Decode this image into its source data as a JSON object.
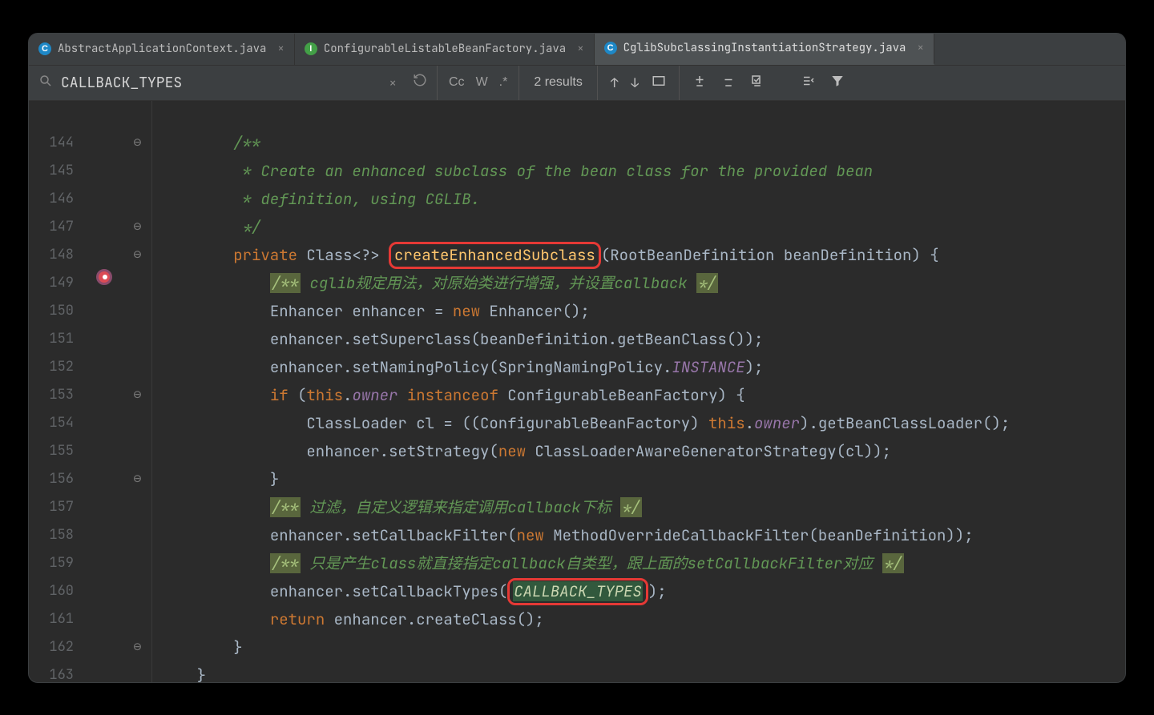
{
  "tabs": [
    {
      "icon": "c",
      "label": "AbstractApplicationContext.java",
      "active": false
    },
    {
      "icon": "i",
      "label": "ConfigurableListableBeanFactory.java",
      "active": false
    },
    {
      "icon": "c",
      "label": "CglibSubclassingInstantiationStrategy.java",
      "active": true
    }
  ],
  "search": {
    "query": "CALLBACK_TYPES",
    "results": "2 results",
    "opts": {
      "case": "Cc",
      "words": "W",
      "regex": ".*"
    }
  },
  "gutter": {
    "lines": [
      "",
      "144",
      "145",
      "146",
      "147",
      "148",
      "149",
      "150",
      "151",
      "152",
      "153",
      "154",
      "155",
      "156",
      "157",
      "158",
      "159",
      "160",
      "161",
      "162",
      "163"
    ],
    "folds": [
      "",
      "⊖",
      "",
      "",
      "⊖",
      "⊖",
      "",
      "",
      "",
      "",
      "⊖",
      "",
      "",
      "⊖",
      "",
      "",
      "",
      "",
      "",
      "⊖",
      ""
    ],
    "breakpoint_row": 5
  },
  "code": {
    "l0": "",
    "l1_ind": "        ",
    "l1_a": "/**",
    "l2_ind": "         ",
    "l2_a": "* Create an enhanced subclass of the bean class for the provided bean",
    "l3_ind": "         ",
    "l3_a": "* definition, using CGLIB.",
    "l4_ind": "         ",
    "l4_a": "*/",
    "l5_ind": "        ",
    "l5_kw": "private",
    "l5_type": " Class<?> ",
    "l5_m": "createEnhancedSubclass",
    "l5_r": "(RootBeanDefinition beanDefinition) {",
    "l6_ind": "            ",
    "l6_hl": "/**",
    "l6_c": " cglib规定用法，对原始类进行增强，并设置callback ",
    "l6_hl2": "*/",
    "l7_ind": "            ",
    "l7_a": "Enhancer enhancer = ",
    "l7_kw": "new",
    "l7_b": " Enhancer();",
    "l8_ind": "            ",
    "l8_a": "enhancer.setSuperclass(beanDefinition.getBeanClass());",
    "l9_ind": "            ",
    "l9_a": "enhancer.setNamingPolicy(SpringNamingPolicy.",
    "l9_s": "INSTANCE",
    "l9_b": ");",
    "l10_ind": "            ",
    "l10_kw": "if",
    "l10_a": " (",
    "l10_kw2": "this",
    "l10_b": ".",
    "l10_f": "owner",
    "l10_c": " ",
    "l10_kw3": "instanceof",
    "l10_d": " ConfigurableBeanFactory) {",
    "l11_ind": "                ",
    "l11_a": "ClassLoader cl = ((ConfigurableBeanFactory) ",
    "l11_kw": "this",
    "l11_b": ".",
    "l11_f": "owner",
    "l11_c": ").getBeanClassLoader();",
    "l12_ind": "                ",
    "l12_a": "enhancer.setStrategy(",
    "l12_kw": "new",
    "l12_b": " ClassLoaderAwareGeneratorStrategy(cl));",
    "l13_ind": "            ",
    "l13_a": "}",
    "l14_ind": "            ",
    "l14_hl": "/**",
    "l14_c": " 过滤，自定义逻辑来指定调用callback下标 ",
    "l14_hl2": "*/",
    "l15_ind": "            ",
    "l15_a": "enhancer.setCallbackFilter(",
    "l15_kw": "new",
    "l15_b": " MethodOverrideCallbackFilter(beanDefinition));",
    "l16_ind": "            ",
    "l16_hl": "/**",
    "l16_c": " 只是产生class就直接指定callback自类型，跟上面的setCallbackFilter对应 ",
    "l16_hl2": "*/",
    "l17_ind": "            ",
    "l17_a": "enhancer.setCallbackTypes(",
    "l17_s": "CALLBACK_TYPES",
    "l17_b": ");",
    "l18_ind": "            ",
    "l18_kw": "return",
    "l18_a": " enhancer.createClass();",
    "l19_ind": "        ",
    "l19_a": "}",
    "l20_ind": "    ",
    "l20_a": "}"
  }
}
